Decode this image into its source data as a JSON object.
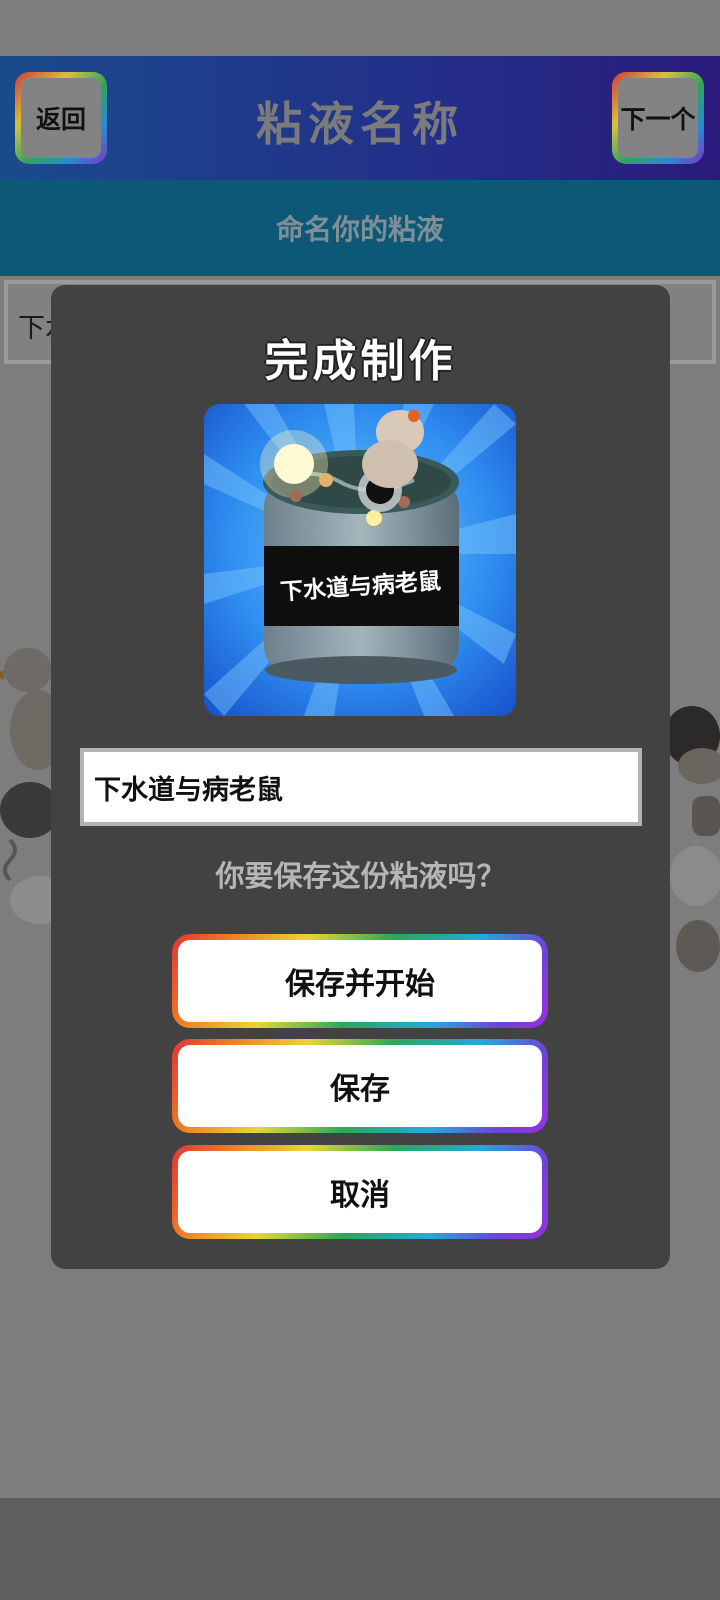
{
  "header": {
    "back_label": "返回",
    "title": "粘液名称",
    "next_label": "下一个"
  },
  "subheader": {
    "text": "命名你的粘液"
  },
  "background_input": {
    "value": "下水"
  },
  "dialog": {
    "title": "完成制作",
    "jar_label": "下水道与病老鼠",
    "name_value": "下水道与病老鼠",
    "question": "你要保存这份粘液吗？",
    "buttons": {
      "save_and_start": "保存并开始",
      "save": "保存",
      "cancel": "取消"
    }
  },
  "icons": {
    "preview": "slime-jar-image",
    "character_left": "duck-character",
    "character_right": "character-figure"
  },
  "colors": {
    "header_start": "#1b4a8c",
    "header_end": "#2a1a7c",
    "subheader": "#0d5876",
    "dialog_bg": "#424242",
    "preview_bg": "#2d8ee8"
  }
}
